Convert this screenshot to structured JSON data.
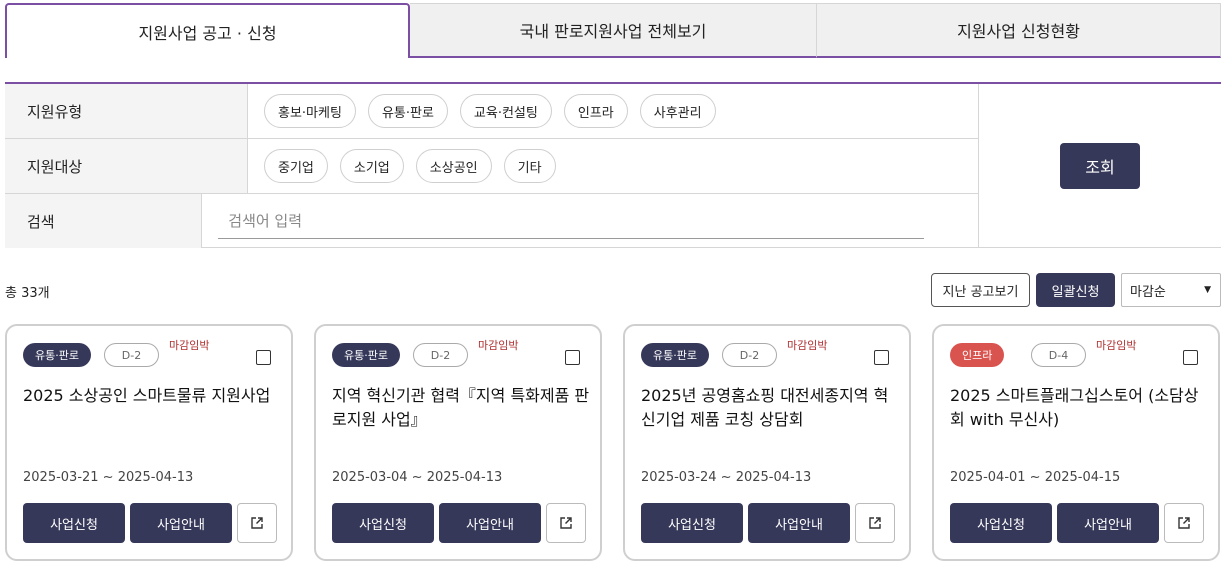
{
  "tabs": [
    {
      "label": "지원사업 공고 · 신청",
      "active": true
    },
    {
      "label": "국내 판로지원사업 전체보기",
      "active": false
    },
    {
      "label": "지원사업 신청현황",
      "active": false
    }
  ],
  "filter": {
    "type_label": "지원유형",
    "type_options": [
      "홍보·마케팅",
      "유통·판로",
      "교육·컨설팅",
      "인프라",
      "사후관리"
    ],
    "target_label": "지원대상",
    "target_options": [
      "중기업",
      "소기업",
      "소상공인",
      "기타"
    ],
    "search_label": "검색",
    "search_placeholder": "검색어 입력",
    "search_button": "조회"
  },
  "list": {
    "total": "총 33개",
    "past_button": "지난 공고보기",
    "bulk_button": "일괄신청",
    "sort_value": "마감순"
  },
  "cards": [
    {
      "category": "유통·판로",
      "dday": "D-2",
      "urgent": "마감임박",
      "title": "2025 소상공인 스마트물류 지원사업",
      "period": "2025-03-21 ~ 2025-04-13",
      "apply": "사업신청",
      "info": "사업안내"
    },
    {
      "category": "유통·판로",
      "dday": "D-2",
      "urgent": "마감임박",
      "title": "지역 혁신기관 협력『지역 특화제품 판로지원 사업』",
      "period": "2025-03-04 ~ 2025-04-13",
      "apply": "사업신청",
      "info": "사업안내"
    },
    {
      "category": "유통·판로",
      "dday": "D-2",
      "urgent": "마감임박",
      "title": "2025년 공영홈쇼핑 대전세종지역 혁신기업 제품 코칭 상담회",
      "period": "2025-03-24 ~ 2025-04-13",
      "apply": "사업신청",
      "info": "사업안내"
    },
    {
      "category": "인프라",
      "dday": "D-4",
      "urgent": "마감임박",
      "title": "2025 스마트플래그십스토어 (소담상회 with 무신사)",
      "period": "2025-04-01 ~ 2025-04-15",
      "apply": "사업신청",
      "info": "사업안내"
    }
  ],
  "colors": {
    "primary": "#363859",
    "accent": "#7b4fa3",
    "urgent": "#b03030",
    "infra_badge": "#d9534f"
  },
  "icons": {
    "external": "external-link-icon",
    "sort": "caret-down-icon"
  }
}
